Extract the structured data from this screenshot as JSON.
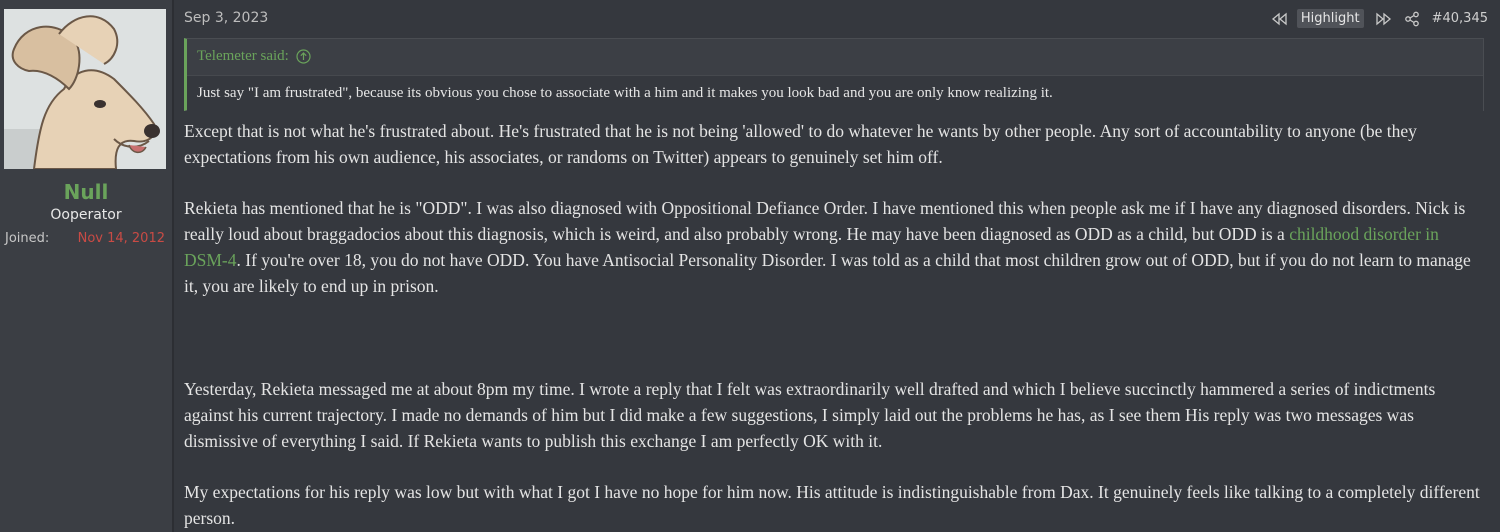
{
  "user": {
    "name": "Null",
    "title": "Ooperator",
    "joined_label": "Joined:",
    "joined_value": "Nov 14, 2012"
  },
  "post": {
    "date": "Sep 3, 2023",
    "highlight_label": "Highlight",
    "number": "#40,345",
    "quote": {
      "author_label": "Telemeter said:",
      "text": "Just say \"I am frustrated\", because its obvious you chose to associate with a him and it makes you look bad and you are only know realizing it."
    },
    "paragraphs": {
      "p1": "Except that is not what he's frustrated about. He's frustrated that he is not being 'allowed' to do whatever he wants by other people. Any sort of accountability to anyone (be they expectations from his own audience, his associates, or randoms on Twitter) appears to genuinely set him off.",
      "p2_before": "Rekieta has mentioned that he is \"ODD\". I was also diagnosed with Oppositional Defiance Order. I have mentioned this when people ask me if I have any diagnosed disorders. Nick is really loud about braggadocios about this diagnosis, which is weird, and also probably wrong. He may have been diagnosed as ODD as a child, but ODD is a ",
      "p2_link": "childhood disorder in DSM-4",
      "p2_after": ". If you're over 18, you do not have ODD. You have Antisocial Personality Disorder. I was told as a child that most children grow out of ODD, but if you do not learn to manage it, you are likely to end up in prison.",
      "p3": "Yesterday, Rekieta messaged me at about 8pm my time. I wrote a reply that I felt was extraordinarily well drafted and which I believe succinctly hammered a series of indictments against his current trajectory. I made no demands of him but I did make a few suggestions, I simply laid out the problems he has, as I see them His reply was two messages was dismissive of everything I said. If Rekieta wants to publish this exchange I am perfectly OK with it.",
      "p4": "My expectations for his reply was low but with what I got I have no hope for him now. His attitude is indistinguishable from Dax. It genuinely feels like talking to a completely different person."
    }
  },
  "colors": {
    "accent_green": "#6aa35b",
    "joined_red": "#c94b45",
    "background": "#32353b"
  },
  "icons": {
    "prev": "rewind-icon",
    "next": "fast-forward-icon",
    "share": "share-icon",
    "quote_jump": "arrow-up-circle-icon"
  }
}
